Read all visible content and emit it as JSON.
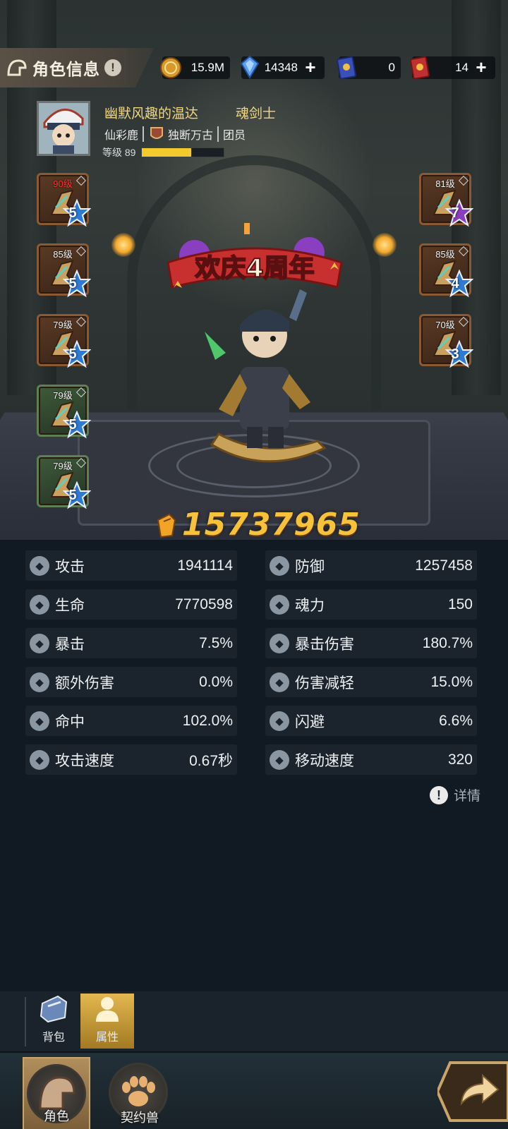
{
  "header": {
    "title": "角色信息",
    "info_mark": "!"
  },
  "currencies": [
    {
      "name": "gold",
      "value": "15.9M",
      "has_plus": false
    },
    {
      "name": "diamond",
      "value": "14348",
      "has_plus": true
    },
    {
      "name": "ticket-blue",
      "value": "0",
      "has_plus": false
    },
    {
      "name": "ticket-red",
      "value": "14",
      "has_plus": true
    }
  ],
  "player": {
    "name": "幽默风趣的温达",
    "class": "魂剑士",
    "server": "仙彩鹿",
    "guild": "独断万古",
    "role": "团员",
    "level_label": "等级 89",
    "level_progress": 0.6
  },
  "equipment": {
    "left": [
      {
        "level": "90级",
        "stars": "5",
        "level_color": "red",
        "frame": "brown"
      },
      {
        "level": "85级",
        "stars": "5",
        "level_color": "white",
        "frame": "brown"
      },
      {
        "level": "79级",
        "stars": "5",
        "level_color": "white",
        "frame": "brown"
      },
      {
        "level": "79级",
        "stars": "5",
        "level_color": "white",
        "frame": "green"
      },
      {
        "level": "79级",
        "stars": "5",
        "level_color": "white",
        "frame": "green"
      }
    ],
    "right": [
      {
        "level": "81级",
        "stars": "7",
        "level_color": "white",
        "frame": "brown"
      },
      {
        "level": "85级",
        "stars": "4",
        "level_color": "white",
        "frame": "brown"
      },
      {
        "level": "70级",
        "stars": "3",
        "level_color": "white",
        "frame": "brown"
      }
    ]
  },
  "banner": {
    "text": "欢庆4周年"
  },
  "power": {
    "value": "15737965"
  },
  "stats": [
    {
      "icon": "sword-icon",
      "label": "攻击",
      "value": "1941114"
    },
    {
      "icon": "shield-icon",
      "label": "防御",
      "value": "1257458"
    },
    {
      "icon": "heart-icon",
      "label": "生命",
      "value": "7770598"
    },
    {
      "icon": "soul-icon",
      "label": "魂力",
      "value": "150"
    },
    {
      "icon": "crit-icon",
      "label": "暴击",
      "value": "7.5%"
    },
    {
      "icon": "crit-damage-icon",
      "label": "暴击伤害",
      "value": "180.7%"
    },
    {
      "icon": "extra-damage-icon",
      "label": "额外伤害",
      "value": "0.0%"
    },
    {
      "icon": "damage-reduction-icon",
      "label": "伤害减轻",
      "value": "15.0%"
    },
    {
      "icon": "accuracy-icon",
      "label": "命中",
      "value": "102.0%"
    },
    {
      "icon": "dodge-icon",
      "label": "闪避",
      "value": "6.6%"
    },
    {
      "icon": "attack-speed-icon",
      "label": "攻击速度",
      "value": "0.67秒"
    },
    {
      "icon": "move-speed-icon",
      "label": "移动速度",
      "value": "320"
    }
  ],
  "detail": {
    "mark": "!",
    "label": "详情"
  },
  "tabs": [
    {
      "label": "背包",
      "active": false
    },
    {
      "label": "属性",
      "active": true
    }
  ],
  "nav": [
    {
      "label": "角色",
      "active": true
    },
    {
      "label": "契约兽",
      "active": false
    }
  ],
  "colors": {
    "gold_text": "#f1d77f",
    "power": "#f6c23a",
    "level_bar": "#f4c92e",
    "panel_bg": "#111a22",
    "stat_row_bg": "#1b242d",
    "active_tab": "#e3b750"
  }
}
